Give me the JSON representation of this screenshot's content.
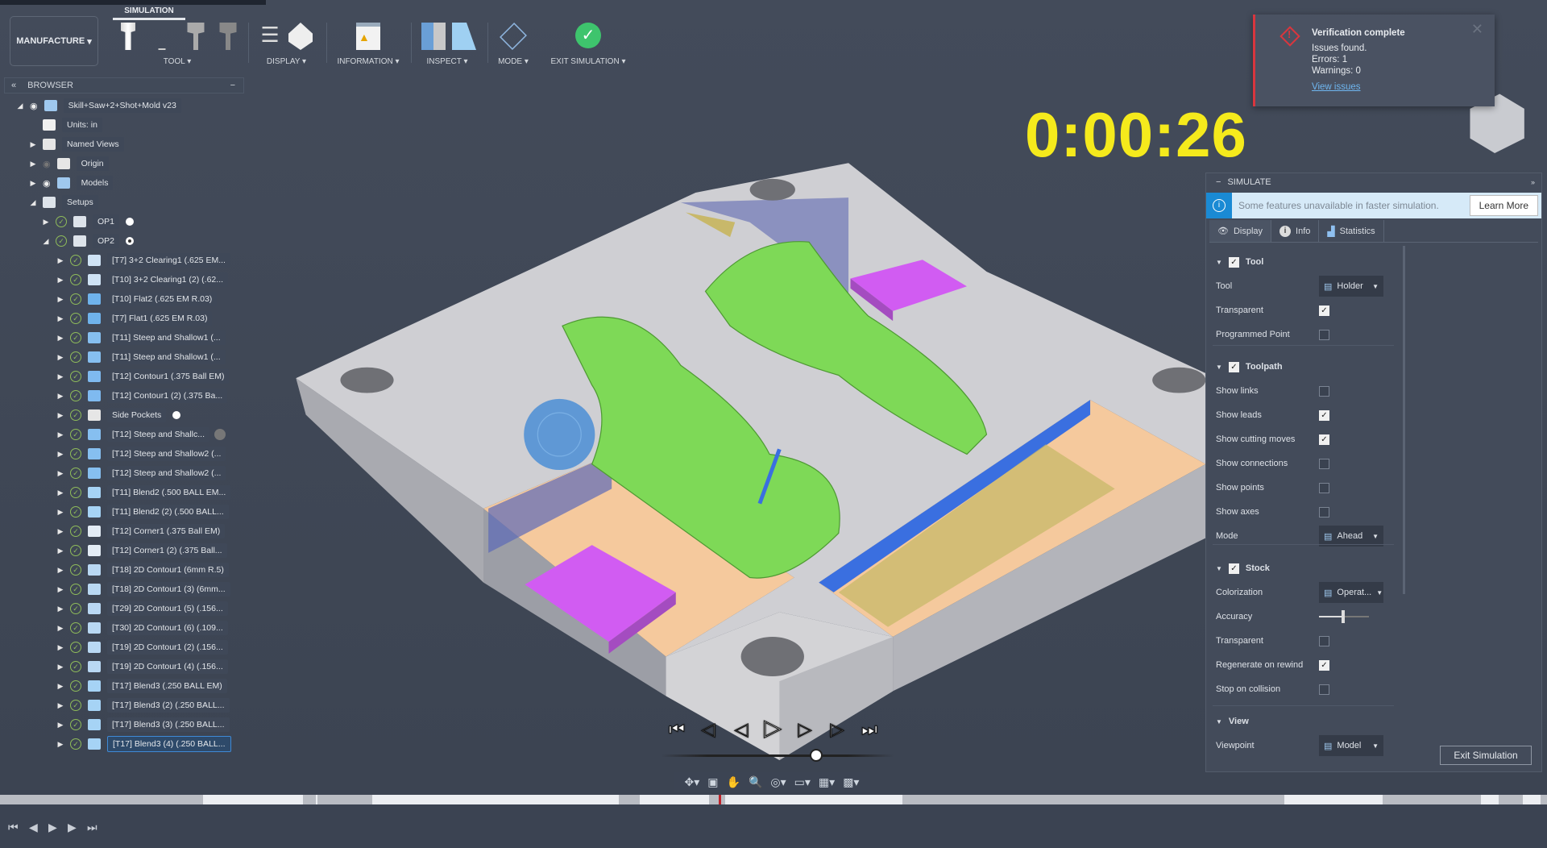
{
  "toolbar": {
    "workspace": "MANUFACTURE",
    "active_tab": "SIMULATION",
    "groups": [
      "TOOL",
      "DISPLAY",
      "INFORMATION",
      "INSPECT",
      "MODE",
      "EXIT SIMULATION"
    ]
  },
  "browser": {
    "title": "BROWSER",
    "items": [
      {
        "label": "Skill+Saw+2+Shot+Mold v23",
        "level": 0,
        "tri": "open",
        "eye": true,
        "icon": "component",
        "check": false
      },
      {
        "label": "Units: in",
        "level": 1,
        "tri": "none",
        "icon": "document",
        "check": false
      },
      {
        "label": "Named Views",
        "level": 1,
        "tri": "closed",
        "icon": "folder",
        "check": false
      },
      {
        "label": "Origin",
        "level": 1,
        "tri": "closed",
        "eye": "hidden",
        "icon": "folder",
        "check": false
      },
      {
        "label": "Models",
        "level": 1,
        "tri": "closed",
        "eye": true,
        "icon": "component",
        "check": false
      },
      {
        "label": "Setups",
        "level": 1,
        "tri": "open",
        "icon": "setup",
        "check": false
      },
      {
        "label": "OP1",
        "level": 2,
        "tri": "closed",
        "icon": "setup",
        "check": true,
        "dot": "filled"
      },
      {
        "label": "OP2",
        "level": 2,
        "tri": "open",
        "icon": "setup",
        "check": true,
        "dot": "ring"
      },
      {
        "label": "[T7] 3+2 Clearing1 (.625 EM...",
        "level": 3,
        "tri": "closed",
        "icon": "clearing",
        "check": true
      },
      {
        "label": "[T10] 3+2 Clearing1 (2) (.62...",
        "level": 3,
        "tri": "closed",
        "icon": "clearing",
        "check": true
      },
      {
        "label": "[T10] Flat2 (.625 EM R.03)",
        "level": 3,
        "tri": "closed",
        "icon": "flat",
        "check": true
      },
      {
        "label": "[T7] Flat1 (.625 EM R.03)",
        "level": 3,
        "tri": "closed",
        "icon": "flat",
        "check": true
      },
      {
        "label": "[T11] Steep and Shallow1 (...",
        "level": 3,
        "tri": "closed",
        "icon": "steep",
        "check": true
      },
      {
        "label": "[T11] Steep and Shallow1 (...",
        "level": 3,
        "tri": "closed",
        "icon": "steep",
        "check": true
      },
      {
        "label": "[T12] Contour1 (.375 Ball EM)",
        "level": 3,
        "tri": "closed",
        "icon": "contour",
        "check": true
      },
      {
        "label": "[T12] Contour1 (2) (.375 Ba...",
        "level": 3,
        "tri": "closed",
        "icon": "contour",
        "check": true
      },
      {
        "label": "Side Pockets",
        "level": 3,
        "tri": "closed",
        "icon": "folder",
        "check": true,
        "dot": "filled"
      },
      {
        "label": "[T12] Steep and Shallc...",
        "level": 3,
        "tri": "closed",
        "icon": "steep",
        "check": true,
        "edit": true
      },
      {
        "label": "[T12] Steep and Shallow2 (...",
        "level": 3,
        "tri": "closed",
        "icon": "steep",
        "check": true
      },
      {
        "label": "[T12] Steep and Shallow2 (...",
        "level": 3,
        "tri": "closed",
        "icon": "steep",
        "check": true
      },
      {
        "label": "[T11] Blend2 (.500 BALL EM...",
        "level": 3,
        "tri": "closed",
        "icon": "blend",
        "check": true
      },
      {
        "label": "[T11] Blend2 (2) (.500 BALL...",
        "level": 3,
        "tri": "closed",
        "icon": "blend",
        "check": true
      },
      {
        "label": "[T12] Corner1 (.375 Ball EM)",
        "level": 3,
        "tri": "closed",
        "icon": "corner",
        "check": true
      },
      {
        "label": "[T12] Corner1 (2) (.375 Ball...",
        "level": 3,
        "tri": "closed",
        "icon": "corner",
        "check": true
      },
      {
        "label": "[T18] 2D Contour1 (6mm R.5)",
        "level": 3,
        "tri": "closed",
        "icon": "contour2d",
        "check": true
      },
      {
        "label": "[T18] 2D Contour1 (3) (6mm...",
        "level": 3,
        "tri": "closed",
        "icon": "contour2d",
        "check": true
      },
      {
        "label": "[T29] 2D Contour1 (5) (.156...",
        "level": 3,
        "tri": "closed",
        "icon": "contour2d",
        "check": true
      },
      {
        "label": "[T30] 2D Contour1 (6) (.109...",
        "level": 3,
        "tri": "closed",
        "icon": "contour2d",
        "check": true
      },
      {
        "label": "[T19] 2D Contour1 (2) (.156...",
        "level": 3,
        "tri": "closed",
        "icon": "contour2d",
        "check": true
      },
      {
        "label": "[T19] 2D Contour1 (4) (.156...",
        "level": 3,
        "tri": "closed",
        "icon": "contour2d",
        "check": true
      },
      {
        "label": "[T17] Blend3 (.250 BALL EM)",
        "level": 3,
        "tri": "closed",
        "icon": "blend",
        "check": true
      },
      {
        "label": "[T17] Blend3 (2) (.250 BALL...",
        "level": 3,
        "tri": "closed",
        "icon": "blend",
        "check": true
      },
      {
        "label": "[T17] Blend3 (3) (.250 BALL...",
        "level": 3,
        "tri": "closed",
        "icon": "blend",
        "check": true
      },
      {
        "label": "[T17] Blend3 (4) (.250 BALL...",
        "level": 3,
        "tri": "closed",
        "icon": "blend",
        "check": true,
        "selected": true
      }
    ]
  },
  "timer": "0:00:26",
  "notification": {
    "title": "Verification complete",
    "lines": [
      "Issues found.",
      "Errors: 1",
      "Warnings: 0"
    ],
    "link": "View issues",
    "icon": "error-diamond-icon",
    "accent": "#d9363e"
  },
  "simulate": {
    "title": "SIMULATE",
    "banner": "Some features unavailable in faster simulation.",
    "learn_more": "Learn More",
    "tabs": [
      "Display",
      "Info",
      "Statistics"
    ],
    "tool": {
      "title": "Tool",
      "enabled": true,
      "tool_label": "Tool",
      "tool_value": "Holder",
      "transparent_label": "Transparent",
      "transparent": true,
      "programmed_label": "Programmed Point",
      "programmed": false
    },
    "toolpath": {
      "title": "Toolpath",
      "enabled": true,
      "rows": [
        {
          "label": "Show links",
          "on": false
        },
        {
          "label": "Show leads",
          "on": true
        },
        {
          "label": "Show cutting moves",
          "on": true
        },
        {
          "label": "Show connections",
          "on": false
        },
        {
          "label": "Show points",
          "on": false
        },
        {
          "label": "Show axes",
          "on": false
        }
      ],
      "mode_label": "Mode",
      "mode_value": "Ahead"
    },
    "stock": {
      "title": "Stock",
      "enabled": true,
      "colorization_label": "Colorization",
      "colorization_value": "Operat...",
      "accuracy_label": "Accuracy",
      "accuracy": 0.45,
      "transparent_label": "Transparent",
      "transparent": false,
      "regen_label": "Regenerate on rewind",
      "regen": true,
      "collision_label": "Stop on collision",
      "collision": false
    },
    "view": {
      "title": "View",
      "viewpoint_label": "Viewpoint",
      "viewpoint_value": "Model"
    },
    "exit": "Exit Simulation"
  },
  "playback": {
    "progress": 0.5
  },
  "colors": {
    "timer": "#f5ea1c",
    "stock_green": "#7ed957",
    "magenta": "#d15cf2",
    "peach": "#f7cfa4",
    "accent_blue": "#1e90d6"
  }
}
